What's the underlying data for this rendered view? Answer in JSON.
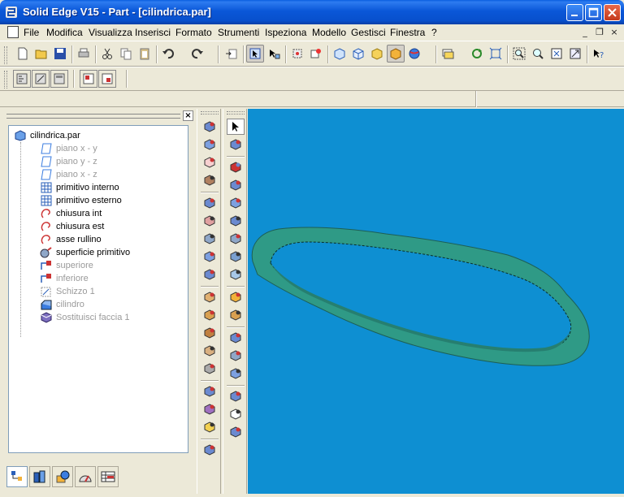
{
  "window": {
    "title": "Solid Edge V15 - Part - [cilindrica.par]",
    "controls": [
      "minimize",
      "maximize",
      "close"
    ]
  },
  "menu": {
    "items": [
      "File",
      "Modifica",
      "Visualizza",
      "Inserisci",
      "Formato",
      "Strumenti",
      "Ispeziona",
      "Modello",
      "Gestisci",
      "Finestra",
      "?"
    ],
    "mdi_controls": [
      "_",
      "❐",
      "×"
    ]
  },
  "toolbar_main": {
    "icons": [
      "new-icon",
      "open-icon",
      "save-icon",
      "print-icon",
      "cut-icon",
      "copy-icon",
      "paste-icon",
      "undo-icon",
      "redo-icon",
      "insert-icon",
      "select-tool-icon",
      "select-options-icon",
      "zoom-part-icon",
      "sketch-icon",
      "view-iso-icon",
      "view-front-icon",
      "view-color-icon",
      "shaded-icon",
      "globe-render-icon",
      "layers-icon",
      "rotate-icon",
      "fit-icon",
      "zoom-area-icon",
      "zoom-icon",
      "fit-all-icon",
      "pan-icon",
      "help-icon"
    ]
  },
  "toolbar_secondary": {
    "icons": [
      "edgebar-icon",
      "ribbon-icon",
      "properties-icon",
      "hide-icon",
      "show-icon"
    ]
  },
  "edgebar": {
    "tree": [
      {
        "label": "cilindrica.par",
        "icon": "part-icon",
        "dim": false
      },
      {
        "label": "piano x - y",
        "icon": "plane-icon",
        "dim": true
      },
      {
        "label": "piano y - z",
        "icon": "plane-icon",
        "dim": true
      },
      {
        "label": "piano x - z",
        "icon": "plane-icon",
        "dim": true
      },
      {
        "label": "primitivo interno",
        "icon": "grid-sketch-icon",
        "dim": false
      },
      {
        "label": "primitivo esterno",
        "icon": "grid-sketch-icon",
        "dim": false
      },
      {
        "label": "chiusura int",
        "icon": "curve-icon",
        "dim": false
      },
      {
        "label": "chiusura est",
        "icon": "curve-icon",
        "dim": false
      },
      {
        "label": "asse rullino",
        "icon": "curve-icon",
        "dim": false
      },
      {
        "label": "superficie primitivo",
        "icon": "surface-icon",
        "dim": false
      },
      {
        "label": "superiore",
        "icon": "surface-offset-icon",
        "dim": true
      },
      {
        "label": "inferiore",
        "icon": "surface-offset-icon",
        "dim": true
      },
      {
        "label": "Schizzo 1",
        "icon": "sketch-icon",
        "dim": true
      },
      {
        "label": "cilindro",
        "icon": "protrusion-icon",
        "dim": true
      },
      {
        "label": "Sostituisci faccia 1",
        "icon": "replace-face-icon",
        "dim": true
      }
    ],
    "tabs": [
      "feature-pathfinder-icon",
      "library-icon",
      "layers-icon",
      "sensors-icon",
      "family-icon"
    ]
  },
  "colors": {
    "viewport_bg": "#0e8fd2",
    "part_fill": "#2f9a86",
    "part_edge": "#1d5f55",
    "titlebar": "#0a57d8"
  }
}
